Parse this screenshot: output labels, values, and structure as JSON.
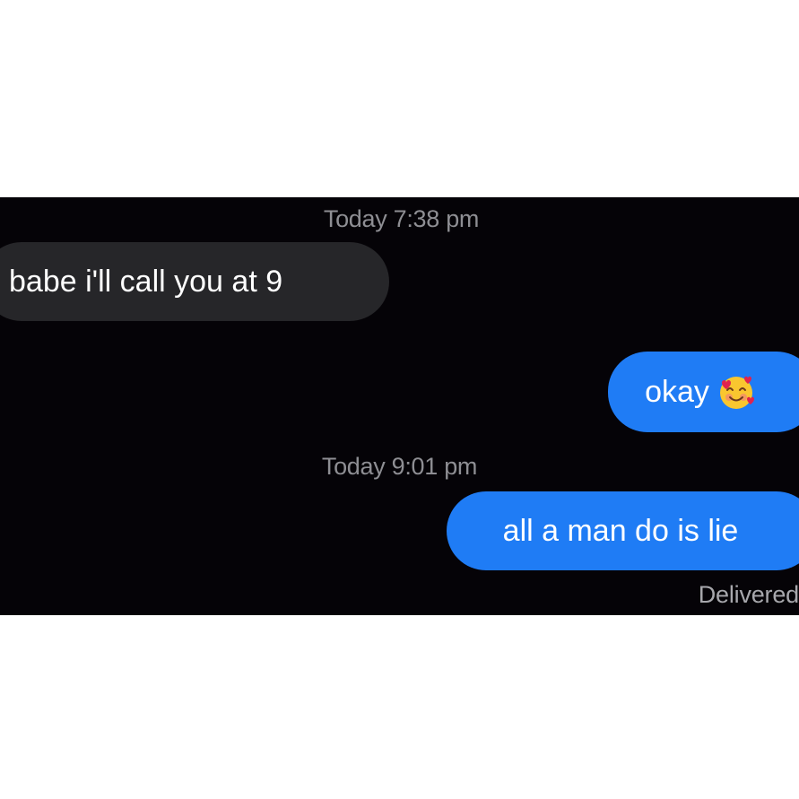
{
  "conversation": {
    "timestamp_1": "Today 7:38 pm",
    "received_message": "babe i'll call you at 9",
    "sent_message_1": "okay",
    "sent_message_1_emoji": "smiling-face-with-hearts-icon",
    "timestamp_2": "Today 9:01 pm",
    "sent_message_2": "all a man do is lie",
    "delivery_status": "Delivered"
  },
  "colors": {
    "background": "#050307",
    "received_bubble": "#262629",
    "sent_bubble": "#1f7cf5",
    "timestamp_text": "#8e8e93"
  }
}
